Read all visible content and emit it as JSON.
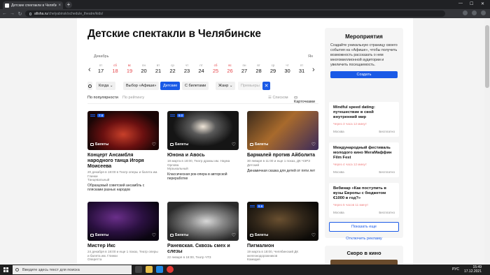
{
  "browser": {
    "tab_title": "Детские спектакли в Челябин…",
    "tab_close": "×",
    "new_tab": "+",
    "url_host": "afisha.ru",
    "url_path": "/chelyabinsk/schedule_theatre/kids/",
    "win_min": "—",
    "win_max": "☐",
    "win_close": "✕",
    "nav_back": "←",
    "nav_fwd": "→",
    "nav_reload": "↻"
  },
  "page": {
    "title": "Детские спектакли в Челябинске",
    "calendar": {
      "month_left": "Декабрь",
      "month_right": "Ян",
      "prev": "‹",
      "next": "›",
      "days": [
        {
          "wd": "пт",
          "dn": "17",
          "weekend": false
        },
        {
          "wd": "сб",
          "dn": "18",
          "weekend": true
        },
        {
          "wd": "вс",
          "dn": "19",
          "weekend": true
        },
        {
          "wd": "пн",
          "dn": "20",
          "weekend": false
        },
        {
          "wd": "вт",
          "dn": "21",
          "weekend": false
        },
        {
          "wd": "ср",
          "dn": "22",
          "weekend": false
        },
        {
          "wd": "чт",
          "dn": "23",
          "weekend": false
        },
        {
          "wd": "пт",
          "dn": "24",
          "weekend": false
        },
        {
          "wd": "сб",
          "dn": "25",
          "weekend": true
        },
        {
          "wd": "вс",
          "dn": "26",
          "weekend": true
        },
        {
          "wd": "пн",
          "dn": "27",
          "weekend": false
        },
        {
          "wd": "вт",
          "dn": "28",
          "weekend": false
        },
        {
          "wd": "ср",
          "dn": "29",
          "weekend": false
        },
        {
          "wd": "чт",
          "dn": "30",
          "weekend": false
        },
        {
          "wd": "пт",
          "dn": "31",
          "weekend": false
        }
      ]
    },
    "filters": {
      "when": "Когда ⌄",
      "choice": "Выбор «Афиши»",
      "kids": "Детские",
      "tickets": "С билетами",
      "genre": "Жанр ⌄",
      "premieres": "Премьеры",
      "clear": "✕"
    },
    "sort": {
      "popular": "По популярности",
      "rating": "По рейтингу",
      "list": "☰ Списком",
      "cards": "▭ Карточками"
    },
    "tickets_label": "Билеты",
    "heart": "♡",
    "cards": [
      {
        "badge": "7.8",
        "title": "Концерт Ансамбля народного танца Игоря Моисеева",
        "meta": "20 декабря в 18:00 в Театр оперы и балета им. Глинки",
        "genre": "Танцевальный",
        "desc": "Образцовый советский ансамбль с плясками разных народов",
        "img": "dance"
      },
      {
        "badge": "9.0",
        "title": "Юнона и Авось",
        "meta": "18 марта в 18:00, Театр драмы им. Наума Орлова",
        "genre": "Музыкальный",
        "desc": "Классическая рок-опера в авторской переработке",
        "img": "juno"
      },
      {
        "badge": "",
        "title": "Бармалей против Айболита",
        "meta": "30 января в 11:00 и еще 1 показ, ДК ЧЭРЗ",
        "genre": "Детский",
        "desc": "Динамичная сказка для детей от пяти лет",
        "img": "barmaley"
      },
      {
        "badge": "",
        "title": "Мистер Икс",
        "meta": "24 декабря в 18:00 и еще 1 показ, Театр оперы и балета им. Глинки",
        "genre": "Оперетта",
        "desc": "",
        "img": "mister"
      },
      {
        "badge": "",
        "title": "Раневская. Сквозь смех и слезы",
        "meta": "22 января в 18:00, Театр ЧТЗ",
        "genre": "",
        "desc": "",
        "img": "ranevskaya"
      },
      {
        "badge": "6.6",
        "title": "Пигмалион",
        "meta": "19 марта в 18:00, Челябинский ДК железнодорожников",
        "genre": "Комедия",
        "desc": "",
        "img": "pygmalion"
      }
    ]
  },
  "sidebar": {
    "title": "Мероприятия",
    "text": "Создайте уникальную страницу своего события на «Афише», чтобы получить возможность рассказать о нем многомиллионной аудитории и увеличить посещаемость.",
    "create": "Создать",
    "events": [
      {
        "title": "Mindful speed dating: путешествие в свой внутренний мир",
        "time": "Через 3 часа 12 минут",
        "place": "Москва",
        "price": "Бесплатно"
      },
      {
        "title": "Международный фестиваль молодого кино МегаМаффин Film Fest",
        "time": "Через 4 часа 12 минут",
        "place": "Москва",
        "price": "Бесплатно"
      },
      {
        "title": "Вебинар «Как поступить в вузы Европы с бюджетом €1000 в год?»",
        "time": "Через 5 часов 11 минут",
        "place": "Москва",
        "price": "Бесплатно"
      }
    ],
    "more": "Показать еще",
    "disable_ads": "Отключить рекламу",
    "soon": "Скоро в кино"
  },
  "taskbar": {
    "search": "Введите здесь текст для поиска",
    "lang": "РУС",
    "time": "15:49",
    "date": "17.12.2021"
  }
}
